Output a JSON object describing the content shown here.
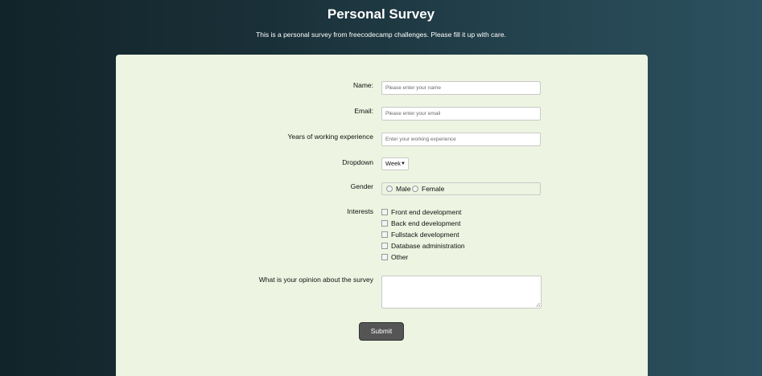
{
  "header": {
    "title": "Personal Survey",
    "description": "This is a personal survey from freecodecamp challenges. Please fill it up with care."
  },
  "form": {
    "name": {
      "label": "Name:",
      "placeholder": "Please enter your name",
      "value": ""
    },
    "email": {
      "label": "Email:",
      "placeholder": "Please enter your email",
      "value": ""
    },
    "experience": {
      "label": "Years of working experience",
      "placeholder": "Enter your working experience",
      "value": ""
    },
    "dropdown": {
      "label": "Dropdown",
      "selected": "Week",
      "arrow_icon": "caret-down-icon"
    },
    "gender": {
      "label": "Gender",
      "options": [
        "Male",
        "Female"
      ],
      "selected": null
    },
    "interests": {
      "label": "Interests",
      "options": [
        "Front end development",
        "Back end development",
        "Fullstack development",
        "Database administration",
        "Other"
      ],
      "checked": [
        false,
        false,
        false,
        false,
        false
      ]
    },
    "opinion": {
      "label": "What is your opinion about the survey",
      "value": ""
    },
    "submit_label": "Submit"
  },
  "colors": {
    "background_start": "#12242a",
    "background_end": "#2c5160",
    "card": "#edf4e1",
    "button": "#555555"
  }
}
